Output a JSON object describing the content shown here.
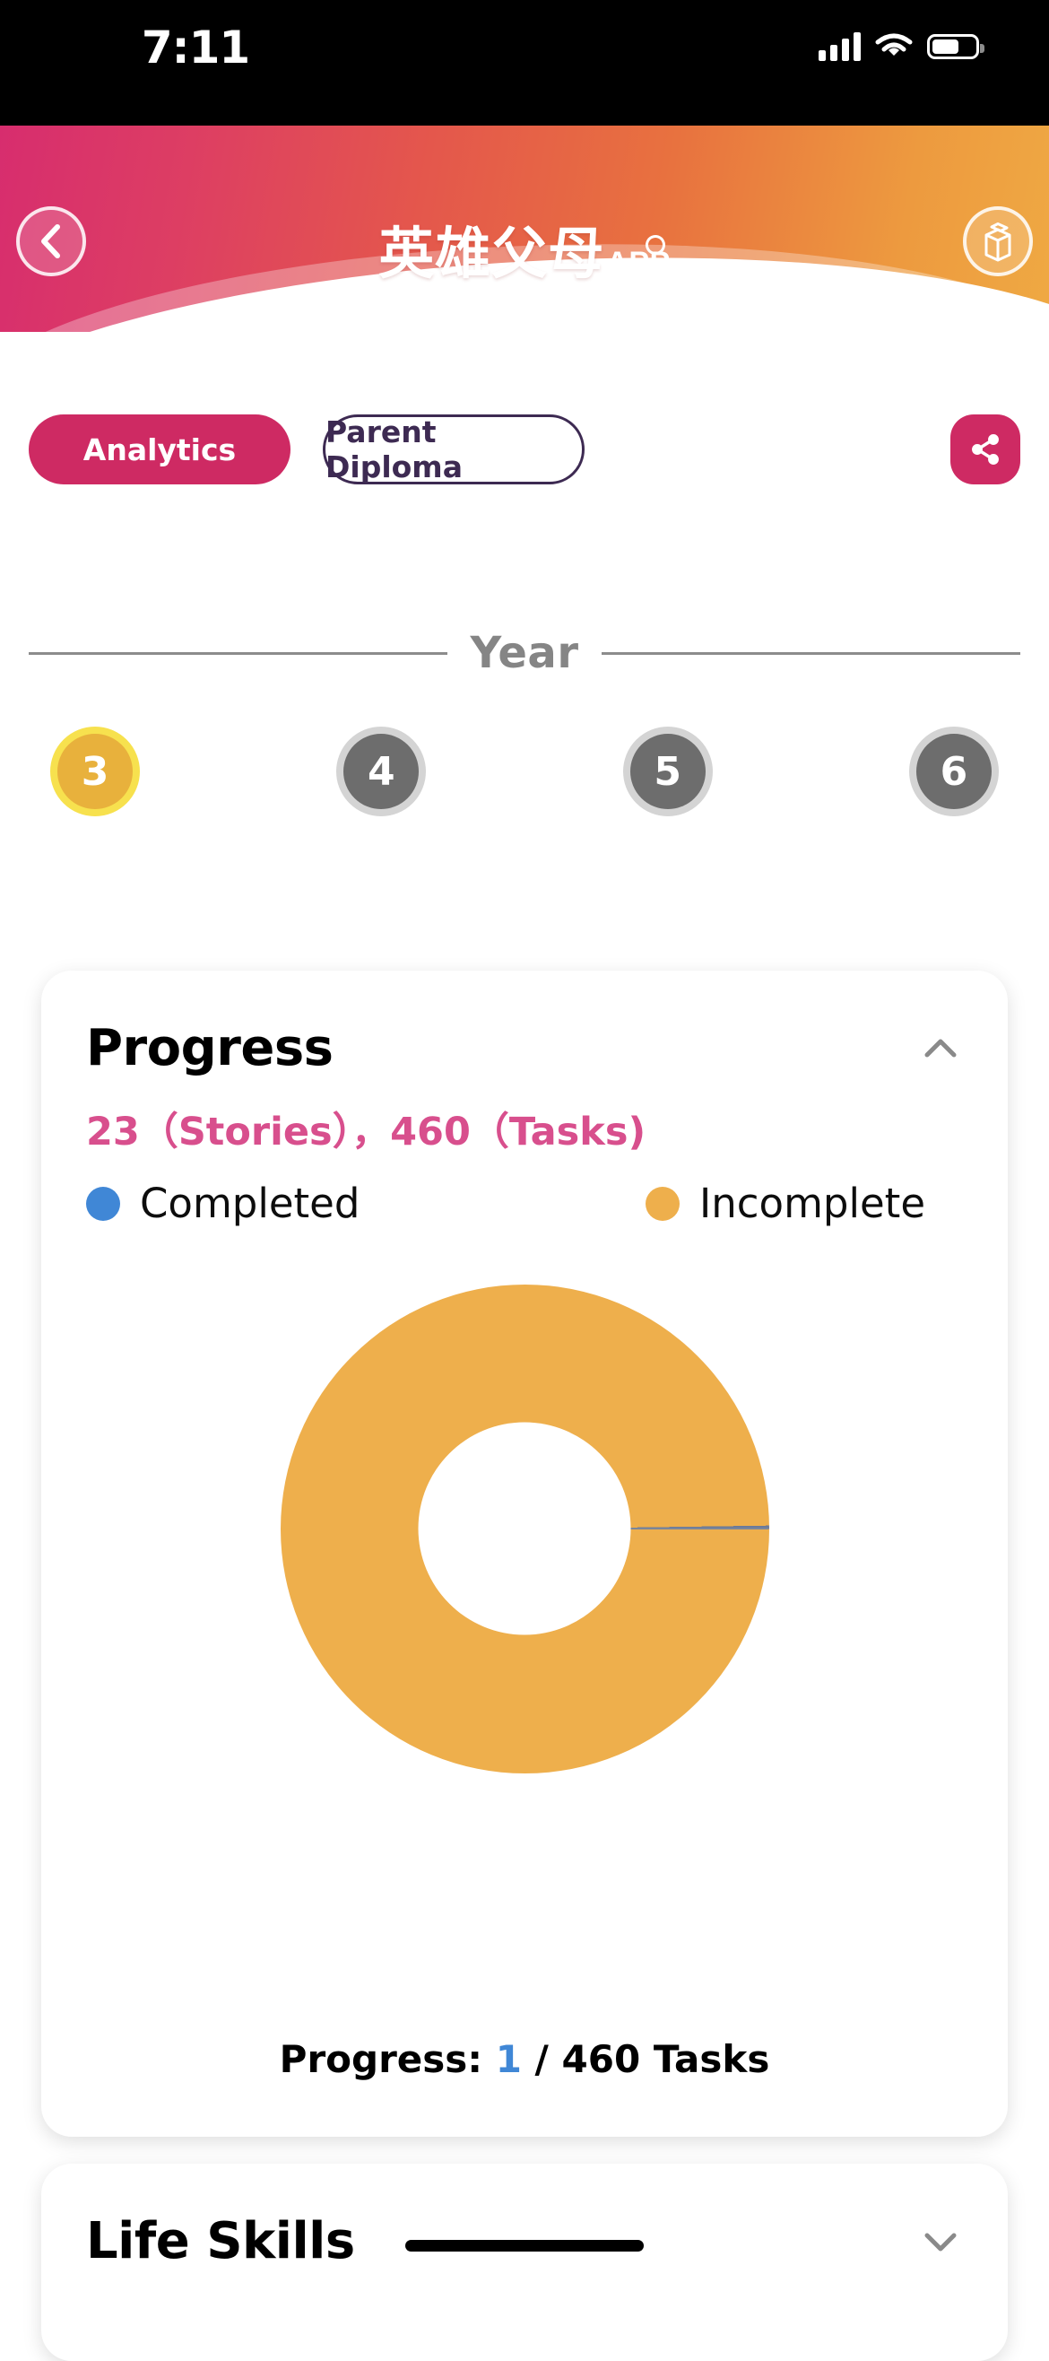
{
  "status_bar": {
    "time": "7:11",
    "icons": [
      "cellular-signal-icon",
      "wifi-icon",
      "battery-icon"
    ]
  },
  "header": {
    "title_cn": "英雄父母",
    "title_app": "APP",
    "back_icon": "chevron-left-icon",
    "right_icon": "milk-carton-icon",
    "gradient_from": "#d72d6e",
    "gradient_to": "#efa943"
  },
  "tabs": {
    "active_label": "Analytics",
    "idle_label": "Parent Diploma",
    "share_icon": "share-icon",
    "accent_color": "#ce2a63",
    "idle_text_color": "#3d2a52"
  },
  "year_section": {
    "label": "Year",
    "options": [
      {
        "value": "3",
        "selected": true
      },
      {
        "value": "4",
        "selected": false
      },
      {
        "value": "5",
        "selected": false
      },
      {
        "value": "6",
        "selected": false
      }
    ],
    "selected_color": "#e8b13c",
    "selected_ring_color": "#f7e14e",
    "normal_color": "#6d6d6d"
  },
  "progress_card": {
    "title": "Progress",
    "collapse_icon": "chevron-up-icon",
    "stats": "23（Stories），460（Tasks)",
    "stats_color": "#d84f8d",
    "legend": [
      {
        "label": "Completed",
        "color": "#4087d6",
        "icon": "legend-dot-blue"
      },
      {
        "label": "Incomplete",
        "color": "#eeaf4c",
        "icon": "legend-dot-orange"
      }
    ],
    "footer_prefix": "Progress: ",
    "footer_value": "1",
    "footer_suffix": " / 460 Tasks",
    "footer_value_color": "#4087d6"
  },
  "life_skills_card": {
    "title": "Life Skills",
    "expand_icon": "chevron-down-icon"
  },
  "chart_data": {
    "type": "pie",
    "title": "Progress",
    "labels": [
      "Completed",
      "Incomplete"
    ],
    "values": [
      1,
      459
    ],
    "total": 460,
    "unit": "Tasks",
    "colors": [
      "#4087d6",
      "#eeaf4c"
    ],
    "donut": true,
    "inner_radius_ratio": 0.435,
    "legend_position": "top",
    "annotations": [
      "Progress: 1 / 460 Tasks",
      "23（Stories），460（Tasks)"
    ]
  }
}
